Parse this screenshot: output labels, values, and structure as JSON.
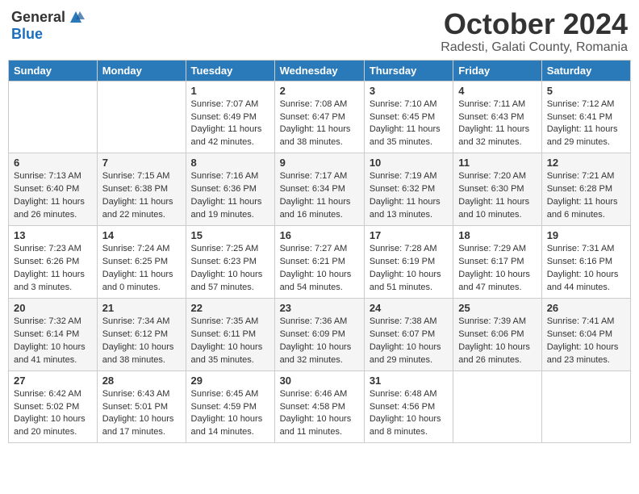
{
  "logo": {
    "general": "General",
    "blue": "Blue"
  },
  "title": "October 2024",
  "location": "Radesti, Galati County, Romania",
  "days_of_week": [
    "Sunday",
    "Monday",
    "Tuesday",
    "Wednesday",
    "Thursday",
    "Friday",
    "Saturday"
  ],
  "weeks": [
    [
      {
        "day": "",
        "info": ""
      },
      {
        "day": "",
        "info": ""
      },
      {
        "day": "1",
        "info": "Sunrise: 7:07 AM\nSunset: 6:49 PM\nDaylight: 11 hours and 42 minutes."
      },
      {
        "day": "2",
        "info": "Sunrise: 7:08 AM\nSunset: 6:47 PM\nDaylight: 11 hours and 38 minutes."
      },
      {
        "day": "3",
        "info": "Sunrise: 7:10 AM\nSunset: 6:45 PM\nDaylight: 11 hours and 35 minutes."
      },
      {
        "day": "4",
        "info": "Sunrise: 7:11 AM\nSunset: 6:43 PM\nDaylight: 11 hours and 32 minutes."
      },
      {
        "day": "5",
        "info": "Sunrise: 7:12 AM\nSunset: 6:41 PM\nDaylight: 11 hours and 29 minutes."
      }
    ],
    [
      {
        "day": "6",
        "info": "Sunrise: 7:13 AM\nSunset: 6:40 PM\nDaylight: 11 hours and 26 minutes."
      },
      {
        "day": "7",
        "info": "Sunrise: 7:15 AM\nSunset: 6:38 PM\nDaylight: 11 hours and 22 minutes."
      },
      {
        "day": "8",
        "info": "Sunrise: 7:16 AM\nSunset: 6:36 PM\nDaylight: 11 hours and 19 minutes."
      },
      {
        "day": "9",
        "info": "Sunrise: 7:17 AM\nSunset: 6:34 PM\nDaylight: 11 hours and 16 minutes."
      },
      {
        "day": "10",
        "info": "Sunrise: 7:19 AM\nSunset: 6:32 PM\nDaylight: 11 hours and 13 minutes."
      },
      {
        "day": "11",
        "info": "Sunrise: 7:20 AM\nSunset: 6:30 PM\nDaylight: 11 hours and 10 minutes."
      },
      {
        "day": "12",
        "info": "Sunrise: 7:21 AM\nSunset: 6:28 PM\nDaylight: 11 hours and 6 minutes."
      }
    ],
    [
      {
        "day": "13",
        "info": "Sunrise: 7:23 AM\nSunset: 6:26 PM\nDaylight: 11 hours and 3 minutes."
      },
      {
        "day": "14",
        "info": "Sunrise: 7:24 AM\nSunset: 6:25 PM\nDaylight: 11 hours and 0 minutes."
      },
      {
        "day": "15",
        "info": "Sunrise: 7:25 AM\nSunset: 6:23 PM\nDaylight: 10 hours and 57 minutes."
      },
      {
        "day": "16",
        "info": "Sunrise: 7:27 AM\nSunset: 6:21 PM\nDaylight: 10 hours and 54 minutes."
      },
      {
        "day": "17",
        "info": "Sunrise: 7:28 AM\nSunset: 6:19 PM\nDaylight: 10 hours and 51 minutes."
      },
      {
        "day": "18",
        "info": "Sunrise: 7:29 AM\nSunset: 6:17 PM\nDaylight: 10 hours and 47 minutes."
      },
      {
        "day": "19",
        "info": "Sunrise: 7:31 AM\nSunset: 6:16 PM\nDaylight: 10 hours and 44 minutes."
      }
    ],
    [
      {
        "day": "20",
        "info": "Sunrise: 7:32 AM\nSunset: 6:14 PM\nDaylight: 10 hours and 41 minutes."
      },
      {
        "day": "21",
        "info": "Sunrise: 7:34 AM\nSunset: 6:12 PM\nDaylight: 10 hours and 38 minutes."
      },
      {
        "day": "22",
        "info": "Sunrise: 7:35 AM\nSunset: 6:11 PM\nDaylight: 10 hours and 35 minutes."
      },
      {
        "day": "23",
        "info": "Sunrise: 7:36 AM\nSunset: 6:09 PM\nDaylight: 10 hours and 32 minutes."
      },
      {
        "day": "24",
        "info": "Sunrise: 7:38 AM\nSunset: 6:07 PM\nDaylight: 10 hours and 29 minutes."
      },
      {
        "day": "25",
        "info": "Sunrise: 7:39 AM\nSunset: 6:06 PM\nDaylight: 10 hours and 26 minutes."
      },
      {
        "day": "26",
        "info": "Sunrise: 7:41 AM\nSunset: 6:04 PM\nDaylight: 10 hours and 23 minutes."
      }
    ],
    [
      {
        "day": "27",
        "info": "Sunrise: 6:42 AM\nSunset: 5:02 PM\nDaylight: 10 hours and 20 minutes."
      },
      {
        "day": "28",
        "info": "Sunrise: 6:43 AM\nSunset: 5:01 PM\nDaylight: 10 hours and 17 minutes."
      },
      {
        "day": "29",
        "info": "Sunrise: 6:45 AM\nSunset: 4:59 PM\nDaylight: 10 hours and 14 minutes."
      },
      {
        "day": "30",
        "info": "Sunrise: 6:46 AM\nSunset: 4:58 PM\nDaylight: 10 hours and 11 minutes."
      },
      {
        "day": "31",
        "info": "Sunrise: 6:48 AM\nSunset: 4:56 PM\nDaylight: 10 hours and 8 minutes."
      },
      {
        "day": "",
        "info": ""
      },
      {
        "day": "",
        "info": ""
      }
    ]
  ]
}
